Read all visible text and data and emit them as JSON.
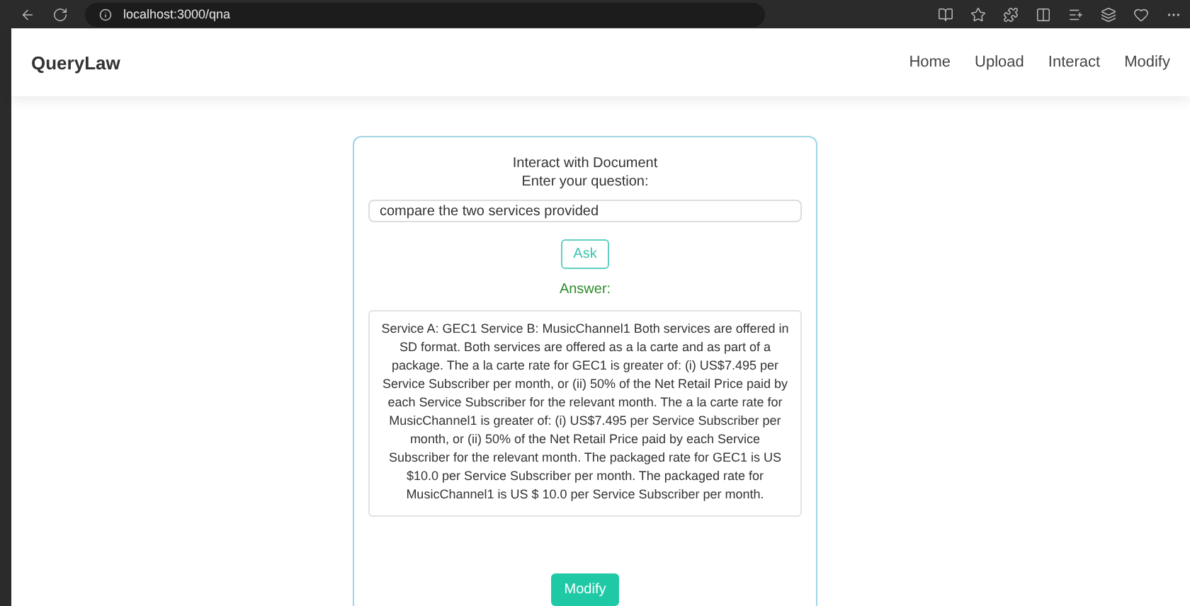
{
  "browser": {
    "url": "localhost:3000/qna"
  },
  "navbar": {
    "brand": "QueryLaw",
    "links": [
      {
        "label": "Home"
      },
      {
        "label": "Upload"
      },
      {
        "label": "Interact"
      },
      {
        "label": "Modify"
      }
    ]
  },
  "card": {
    "title": "Interact with Document",
    "prompt": "Enter your question:",
    "question": {
      "value": "compare the two services provided"
    },
    "ask_button": "Ask",
    "answer_label": "Answer:",
    "answer": "Service A: GEC1 Service B: MusicChannel1 Both services are offered in SD format. Both services are offered as a la carte and as part of a package. The a la carte rate for GEC1 is greater of: (i) US$7.495 per Service Subscriber per month, or (ii) 50% of the Net Retail Price paid by each Service Subscriber for the relevant month. The a la carte rate for MusicChannel1 is greater of: (i) US$7.495 per Service Subscriber per month, or (ii) 50% of the Net Retail Price paid by each Service Subscriber for the relevant month. The packaged rate for GEC1 is US $10.0 per Service Subscriber per month. The packaged rate for MusicChannel1 is US $ 10.0 per Service Subscriber per month.",
    "modify_button": "Modify"
  }
}
